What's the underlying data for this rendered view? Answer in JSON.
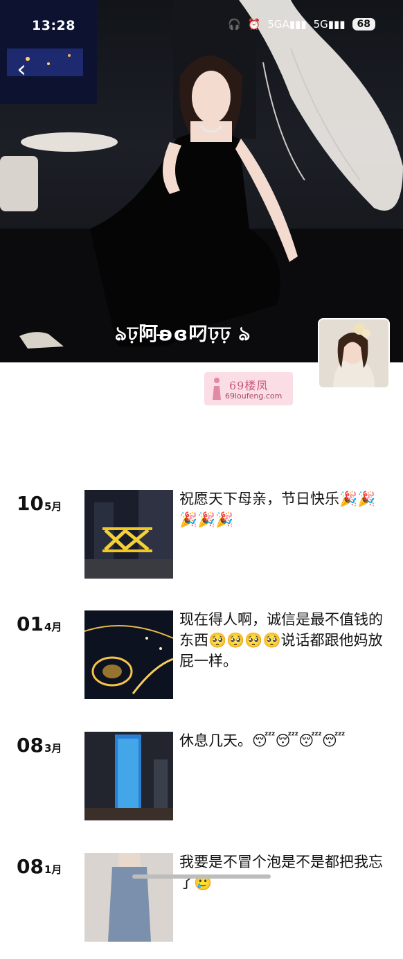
{
  "status_bar": {
    "time": "13:28",
    "icons": [
      "headphones-icon",
      "alarm-icon",
      "signal-5g-icon",
      "signal-5g-icon"
    ],
    "signal_label_1": "5GA",
    "signal_label_2": "5G",
    "battery": "68"
  },
  "profile": {
    "nickname": "ঌ⁠ঢ়阿ʚ̶ɞ叼ঢ়ঢ় ঌ",
    "watermark_title": "69楼凤",
    "watermark_url": "69loufeng.com"
  },
  "posts": [
    {
      "day": "10",
      "month": "5月",
      "text": "祝愿天下母亲，节日快乐🎉🎉🎉🎉🎉"
    },
    {
      "day": "01",
      "month": "4月",
      "text": "现在得人啊，诚信是最不值钱的东西🥺🥺🥺🥺说话都跟他妈放屁一样。"
    },
    {
      "day": "08",
      "month": "3月",
      "text": "休息几天。😴😴😴😴"
    },
    {
      "day": "08",
      "month": "1月",
      "text": "我要是不冒个泡是不是都把我忘了🥲"
    }
  ],
  "colors": {
    "accent_watermark": "#c8587a",
    "text": "#111111",
    "background": "#ffffff"
  }
}
